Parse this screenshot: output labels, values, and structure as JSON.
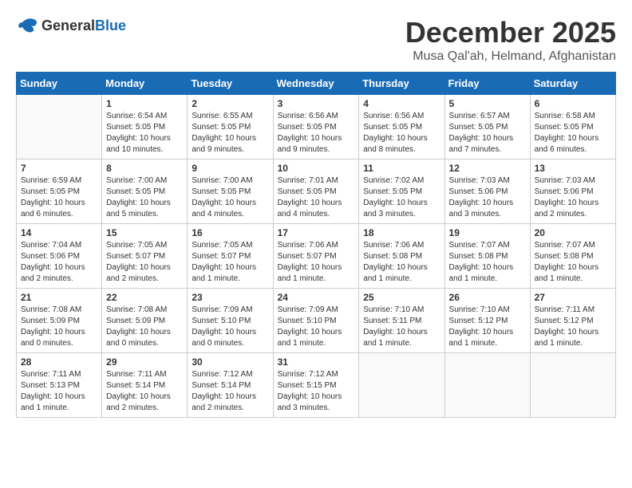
{
  "logo": {
    "general": "General",
    "blue": "Blue"
  },
  "title": "December 2025",
  "location": "Musa Qal'ah, Helmand, Afghanistan",
  "days_of_week": [
    "Sunday",
    "Monday",
    "Tuesday",
    "Wednesday",
    "Thursday",
    "Friday",
    "Saturday"
  ],
  "weeks": [
    [
      {
        "day": "",
        "info": ""
      },
      {
        "day": "1",
        "info": "Sunrise: 6:54 AM\nSunset: 5:05 PM\nDaylight: 10 hours\nand 10 minutes."
      },
      {
        "day": "2",
        "info": "Sunrise: 6:55 AM\nSunset: 5:05 PM\nDaylight: 10 hours\nand 9 minutes."
      },
      {
        "day": "3",
        "info": "Sunrise: 6:56 AM\nSunset: 5:05 PM\nDaylight: 10 hours\nand 9 minutes."
      },
      {
        "day": "4",
        "info": "Sunrise: 6:56 AM\nSunset: 5:05 PM\nDaylight: 10 hours\nand 8 minutes."
      },
      {
        "day": "5",
        "info": "Sunrise: 6:57 AM\nSunset: 5:05 PM\nDaylight: 10 hours\nand 7 minutes."
      },
      {
        "day": "6",
        "info": "Sunrise: 6:58 AM\nSunset: 5:05 PM\nDaylight: 10 hours\nand 6 minutes."
      }
    ],
    [
      {
        "day": "7",
        "info": "Sunrise: 6:59 AM\nSunset: 5:05 PM\nDaylight: 10 hours\nand 6 minutes."
      },
      {
        "day": "8",
        "info": "Sunrise: 7:00 AM\nSunset: 5:05 PM\nDaylight: 10 hours\nand 5 minutes."
      },
      {
        "day": "9",
        "info": "Sunrise: 7:00 AM\nSunset: 5:05 PM\nDaylight: 10 hours\nand 4 minutes."
      },
      {
        "day": "10",
        "info": "Sunrise: 7:01 AM\nSunset: 5:05 PM\nDaylight: 10 hours\nand 4 minutes."
      },
      {
        "day": "11",
        "info": "Sunrise: 7:02 AM\nSunset: 5:05 PM\nDaylight: 10 hours\nand 3 minutes."
      },
      {
        "day": "12",
        "info": "Sunrise: 7:03 AM\nSunset: 5:06 PM\nDaylight: 10 hours\nand 3 minutes."
      },
      {
        "day": "13",
        "info": "Sunrise: 7:03 AM\nSunset: 5:06 PM\nDaylight: 10 hours\nand 2 minutes."
      }
    ],
    [
      {
        "day": "14",
        "info": "Sunrise: 7:04 AM\nSunset: 5:06 PM\nDaylight: 10 hours\nand 2 minutes."
      },
      {
        "day": "15",
        "info": "Sunrise: 7:05 AM\nSunset: 5:07 PM\nDaylight: 10 hours\nand 2 minutes."
      },
      {
        "day": "16",
        "info": "Sunrise: 7:05 AM\nSunset: 5:07 PM\nDaylight: 10 hours\nand 1 minute."
      },
      {
        "day": "17",
        "info": "Sunrise: 7:06 AM\nSunset: 5:07 PM\nDaylight: 10 hours\nand 1 minute."
      },
      {
        "day": "18",
        "info": "Sunrise: 7:06 AM\nSunset: 5:08 PM\nDaylight: 10 hours\nand 1 minute."
      },
      {
        "day": "19",
        "info": "Sunrise: 7:07 AM\nSunset: 5:08 PM\nDaylight: 10 hours\nand 1 minute."
      },
      {
        "day": "20",
        "info": "Sunrise: 7:07 AM\nSunset: 5:08 PM\nDaylight: 10 hours\nand 1 minute."
      }
    ],
    [
      {
        "day": "21",
        "info": "Sunrise: 7:08 AM\nSunset: 5:09 PM\nDaylight: 10 hours\nand 0 minutes."
      },
      {
        "day": "22",
        "info": "Sunrise: 7:08 AM\nSunset: 5:09 PM\nDaylight: 10 hours\nand 0 minutes."
      },
      {
        "day": "23",
        "info": "Sunrise: 7:09 AM\nSunset: 5:10 PM\nDaylight: 10 hours\nand 0 minutes."
      },
      {
        "day": "24",
        "info": "Sunrise: 7:09 AM\nSunset: 5:10 PM\nDaylight: 10 hours\nand 1 minute."
      },
      {
        "day": "25",
        "info": "Sunrise: 7:10 AM\nSunset: 5:11 PM\nDaylight: 10 hours\nand 1 minute."
      },
      {
        "day": "26",
        "info": "Sunrise: 7:10 AM\nSunset: 5:12 PM\nDaylight: 10 hours\nand 1 minute."
      },
      {
        "day": "27",
        "info": "Sunrise: 7:11 AM\nSunset: 5:12 PM\nDaylight: 10 hours\nand 1 minute."
      }
    ],
    [
      {
        "day": "28",
        "info": "Sunrise: 7:11 AM\nSunset: 5:13 PM\nDaylight: 10 hours\nand 1 minute."
      },
      {
        "day": "29",
        "info": "Sunrise: 7:11 AM\nSunset: 5:14 PM\nDaylight: 10 hours\nand 2 minutes."
      },
      {
        "day": "30",
        "info": "Sunrise: 7:12 AM\nSunset: 5:14 PM\nDaylight: 10 hours\nand 2 minutes."
      },
      {
        "day": "31",
        "info": "Sunrise: 7:12 AM\nSunset: 5:15 PM\nDaylight: 10 hours\nand 3 minutes."
      },
      {
        "day": "",
        "info": ""
      },
      {
        "day": "",
        "info": ""
      },
      {
        "day": "",
        "info": ""
      }
    ]
  ]
}
